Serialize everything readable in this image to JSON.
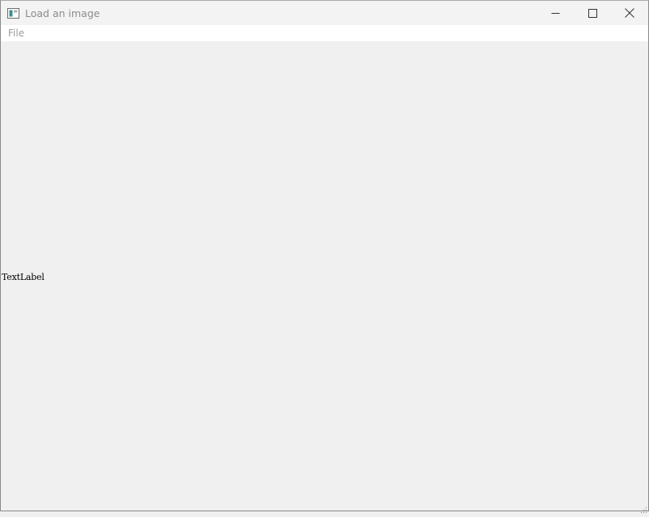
{
  "window": {
    "title": "Load an image",
    "app_icon": "window-app-icon",
    "controls": {
      "minimize_icon": "minimize-icon",
      "maximize_icon": "maximize-icon",
      "close_icon": "close-icon"
    }
  },
  "menubar": {
    "items": [
      {
        "label": "File"
      }
    ]
  },
  "central": {
    "text_label": "TextLabel"
  },
  "colors": {
    "window_bg": "#f0f0f0",
    "titlebar_bg": "#f3f3f3",
    "menubar_bg": "#ffffff",
    "muted_text": "#8c8c8c"
  }
}
